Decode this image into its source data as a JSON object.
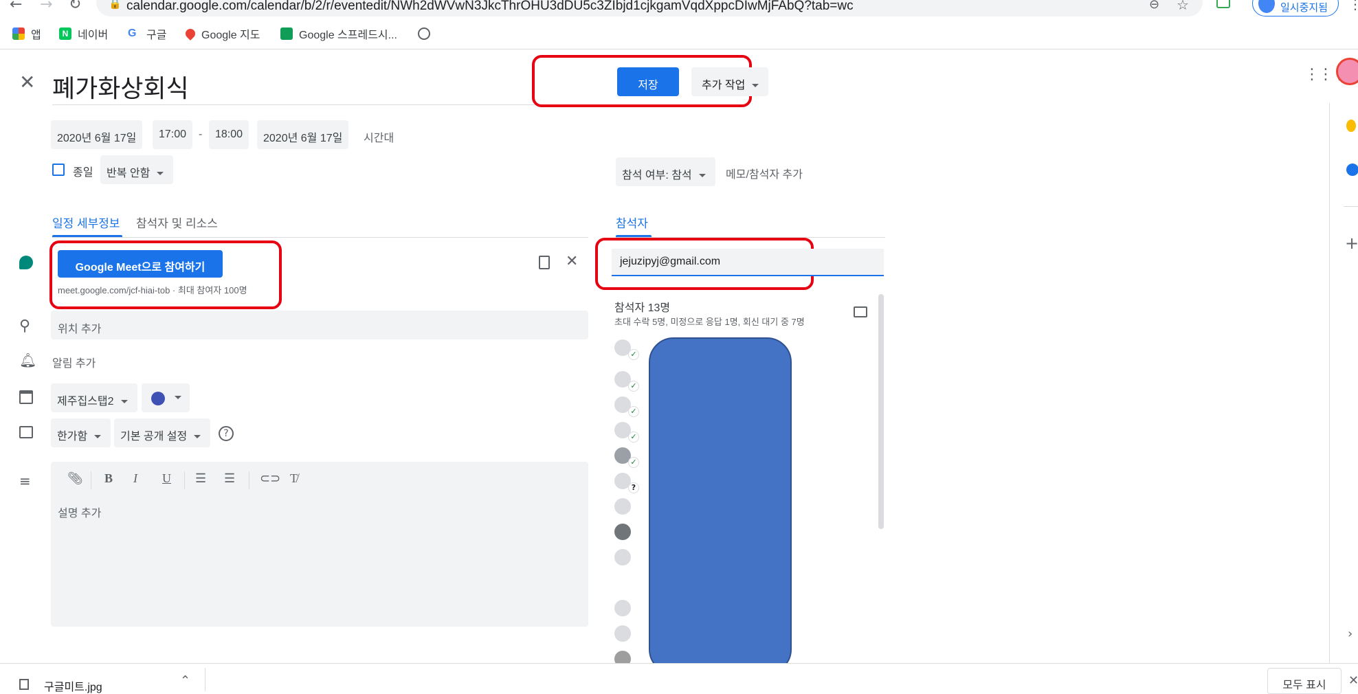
{
  "browser": {
    "url": "calendar.google.com/calendar/b/2/r/eventedit/NWh2dWVwN3JkcThrOHU3dDU5c3ZIbjd1cjkgamVqdXppcDIwMjFAbQ?tab=wc",
    "pause_label": "일시중지됨",
    "bookmarks": [
      "앱",
      "네이버",
      "구글",
      "Google 지도",
      "Google 스프레드시...",
      ""
    ]
  },
  "event": {
    "title": "폐가화상회식",
    "start_date": "2020년 6월 17일",
    "start_time": "17:00",
    "dash": "-",
    "end_time": "18:00",
    "end_date": "2020년 6월 17일",
    "timezone_label": "시간대",
    "allday_label": "종일",
    "repeat_label": "반복 안함"
  },
  "toolbar": {
    "save_label": "저장",
    "more_label": "추가 작업"
  },
  "rsvp": {
    "label": "참석 여부: 참석",
    "add_note_label": "메모/참석자 추가"
  },
  "tabs": {
    "details": "일정 세부정보",
    "guests_resources": "참석자 및 리소스",
    "guests": "참석자"
  },
  "meet": {
    "button_label": "Google Meet으로 참여하기",
    "info": "meet.google.com/jcf-hiai-tob · 최대 참여자 100명"
  },
  "details": {
    "location_placeholder": "위치 추가",
    "notification_label": "알림 추가",
    "calendar_name": "제주집스탭2",
    "calendar_color": "#3f51b5",
    "availability": "한가함",
    "visibility": "기본 공개 설정",
    "description_placeholder": "설명 추가"
  },
  "guests": {
    "input_value": "jejuzipyj@gmail.com",
    "count_label": "참석자 13명",
    "summary": "초대 수락 5명, 미정으로 응답 1명, 회신 대기 중 7명"
  },
  "downloads": {
    "file_name": "구글미트.jpg",
    "show_all_label": "모두 표시"
  }
}
